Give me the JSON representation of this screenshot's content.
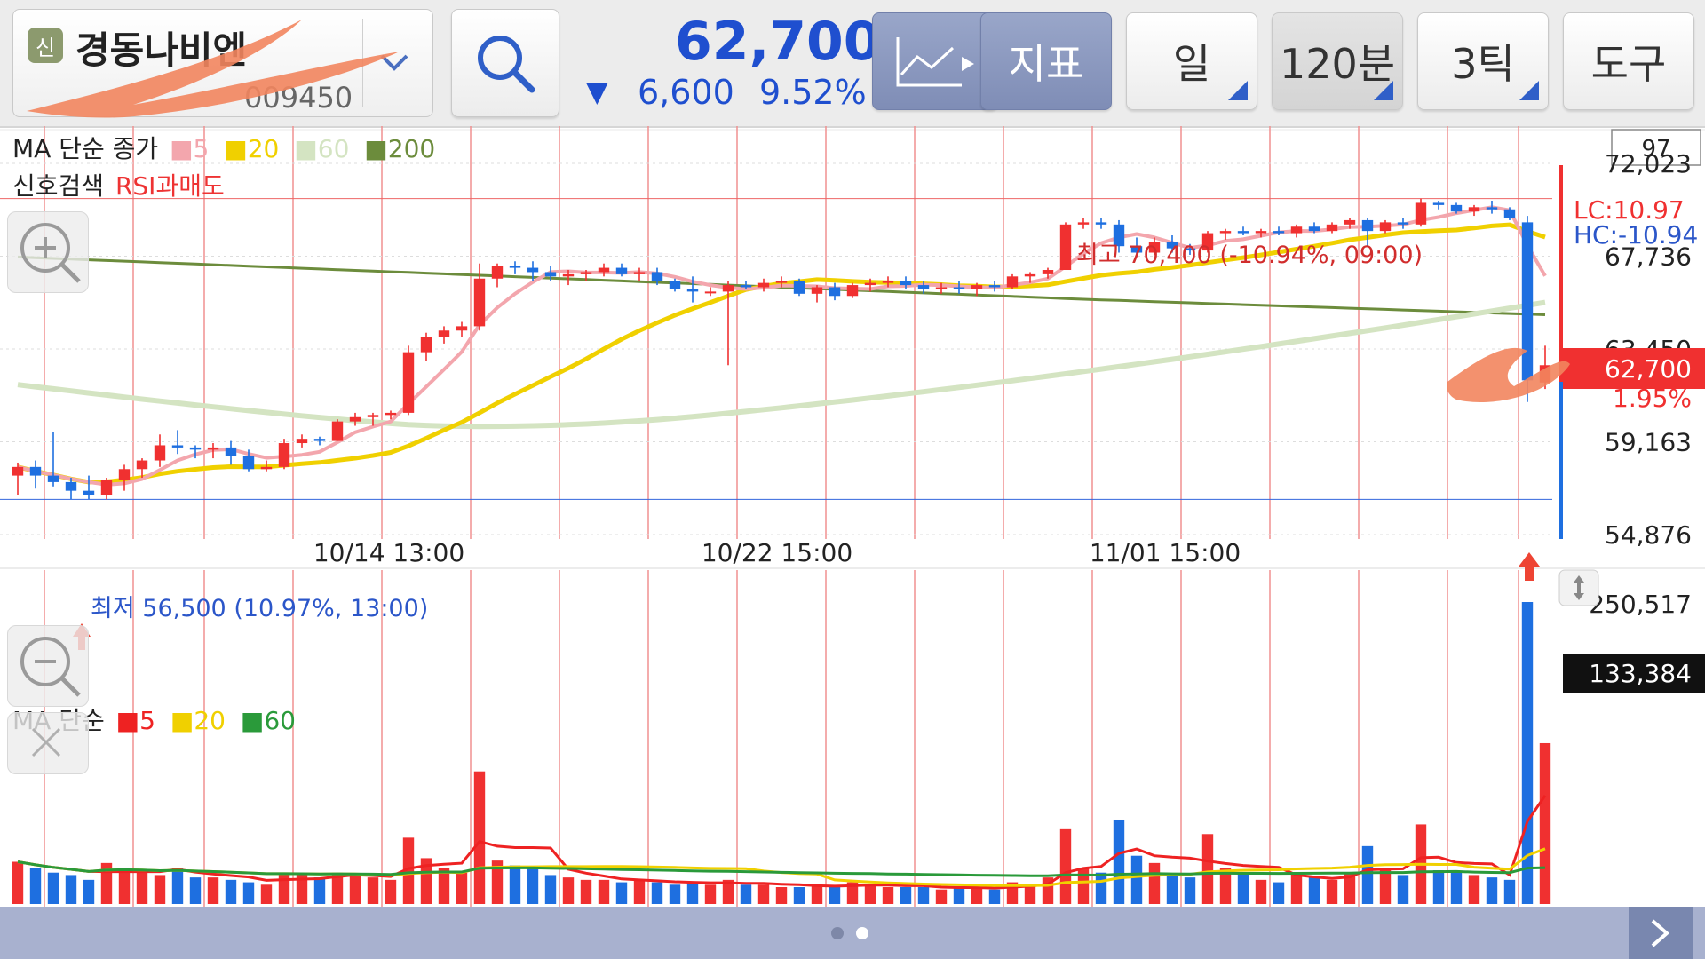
{
  "header": {
    "badge": "신",
    "stock_name": "경동나비엔",
    "stock_code": "009450",
    "price": "62,700",
    "change_arrow": "▼",
    "change_value": "6,600",
    "change_rate": "9.52%",
    "buttons": {
      "indicator": "지표",
      "period": "일",
      "interval": "120분",
      "tick": "3틱",
      "tools": "도구"
    },
    "icons": {
      "search": "search-icon",
      "chart_type": "line-chart-icon",
      "dropdown": "chevron-down-icon"
    }
  },
  "price_legend": {
    "title": "MA 단순 종가",
    "ma": [
      {
        "label": "5",
        "color": "#f3a6ad"
      },
      {
        "label": "20",
        "color": "#f0d000"
      },
      {
        "label": "60",
        "color": "#d4e4c2"
      },
      {
        "label": "200",
        "color": "#6c8c3c"
      }
    ],
    "signal_label": "신호검색",
    "signal_value": "RSI과매도"
  },
  "volume_legend": {
    "title": "MA 단순",
    "ma": [
      {
        "label": "5",
        "color": "#ee2222"
      },
      {
        "label": "20",
        "color": "#f0d000"
      },
      {
        "label": "60",
        "color": "#2a9a3a"
      }
    ]
  },
  "chart_data": {
    "type": "candlestick",
    "price_axis": {
      "ticks": [
        "72,023",
        "67,736",
        "63,450",
        "59,163",
        "54,876"
      ],
      "top_box": "97"
    },
    "current_price_tag": "62,700",
    "current_pct": "1.95%",
    "lc": "LC:10.97",
    "hc": "HC:-10.94",
    "high_annotation": "최고 70,400 (-10.94%, 09:00)",
    "low_annotation": "최저 56,500 (10.97%, 13:00)",
    "x_labels": [
      "10/14 13:00",
      "10/22 15:00",
      "11/01 15:00"
    ],
    "volume_axis": {
      "ticks": [
        "250,517"
      ],
      "current_tag": "133,384"
    },
    "candles": [
      [
        57600,
        58200,
        56700,
        58000
      ],
      [
        58000,
        58300,
        57000,
        57600
      ],
      [
        57600,
        59600,
        57100,
        57300
      ],
      [
        57300,
        57500,
        56500,
        56900
      ],
      [
        56900,
        57600,
        56500,
        56700
      ],
      [
        56700,
        57500,
        56500,
        57400
      ],
      [
        57400,
        58100,
        56900,
        57900
      ],
      [
        57900,
        58400,
        57500,
        58300
      ],
      [
        58300,
        59500,
        58000,
        59000
      ],
      [
        59000,
        59700,
        58600,
        58900
      ],
      [
        58900,
        59000,
        58400,
        58800
      ],
      [
        58800,
        59100,
        58400,
        58900
      ],
      [
        58900,
        59200,
        58100,
        58500
      ],
      [
        58500,
        58800,
        57800,
        57900
      ],
      [
        57900,
        58300,
        57800,
        58000
      ],
      [
        58000,
        59300,
        57900,
        59100
      ],
      [
        59100,
        59500,
        58900,
        59300
      ],
      [
        59300,
        59400,
        59000,
        59200
      ],
      [
        59200,
        60200,
        59200,
        60100
      ],
      [
        60100,
        60500,
        59900,
        60300
      ],
      [
        60300,
        60500,
        59900,
        60400
      ],
      [
        60400,
        60600,
        60200,
        60500
      ],
      [
        60500,
        63600,
        60400,
        63300
      ],
      [
        63300,
        64200,
        62900,
        64000
      ],
      [
        64000,
        64500,
        63700,
        64300
      ],
      [
        64300,
        64700,
        64000,
        64500
      ],
      [
        64500,
        67400,
        64300,
        66700
      ],
      [
        66700,
        67400,
        66300,
        67300
      ],
      [
        67300,
        67500,
        66900,
        67200
      ],
      [
        67200,
        67500,
        66600,
        67000
      ],
      [
        67000,
        67300,
        66600,
        66800
      ],
      [
        66800,
        67100,
        66400,
        66900
      ],
      [
        66900,
        67100,
        66600,
        67000
      ],
      [
        67000,
        67400,
        66800,
        67200
      ],
      [
        67200,
        67400,
        66800,
        66900
      ],
      [
        66900,
        67200,
        66600,
        67000
      ],
      [
        67000,
        67200,
        66400,
        66600
      ],
      [
        66600,
        66700,
        66100,
        66200
      ],
      [
        66200,
        66800,
        65600,
        66100
      ],
      [
        66100,
        66300,
        65900,
        66100
      ],
      [
        66100,
        66600,
        62700,
        66400
      ],
      [
        66400,
        66600,
        66200,
        66300
      ],
      [
        66300,
        66700,
        66100,
        66500
      ],
      [
        66500,
        66800,
        66300,
        66600
      ],
      [
        66600,
        66700,
        65900,
        66000
      ],
      [
        66000,
        66400,
        65600,
        66300
      ],
      [
        66300,
        66500,
        65700,
        65900
      ],
      [
        65900,
        66500,
        65800,
        66400
      ],
      [
        66400,
        66700,
        66100,
        66500
      ],
      [
        66500,
        66800,
        66300,
        66600
      ],
      [
        66600,
        66800,
        66200,
        66400
      ],
      [
        66400,
        66600,
        66000,
        66200
      ],
      [
        66200,
        66500,
        66000,
        66300
      ],
      [
        66300,
        66600,
        66000,
        66200
      ],
      [
        66200,
        66500,
        65900,
        66400
      ],
      [
        66400,
        66600,
        66100,
        66300
      ],
      [
        66300,
        66900,
        66200,
        66800
      ],
      [
        66800,
        67000,
        66500,
        66900
      ],
      [
        66900,
        67200,
        66700,
        67100
      ],
      [
        67100,
        69300,
        67100,
        69200
      ],
      [
        69200,
        69500,
        69000,
        69300
      ],
      [
        69300,
        69500,
        69000,
        69200
      ],
      [
        69200,
        69400,
        67900,
        68200
      ],
      [
        68200,
        68600,
        67700,
        67900
      ],
      [
        67900,
        68600,
        67800,
        68400
      ],
      [
        68400,
        68700,
        67900,
        68100
      ],
      [
        68100,
        68300,
        67800,
        68000
      ],
      [
        68000,
        68900,
        67900,
        68800
      ],
      [
        68800,
        69000,
        68500,
        68900
      ],
      [
        68900,
        69100,
        68700,
        68800
      ],
      [
        68800,
        69000,
        68600,
        68900
      ],
      [
        68900,
        69100,
        68700,
        68800
      ],
      [
        68800,
        69200,
        68600,
        69100
      ],
      [
        69100,
        69300,
        68800,
        68900
      ],
      [
        68900,
        69300,
        68800,
        69200
      ],
      [
        69200,
        69500,
        69000,
        69400
      ],
      [
        69400,
        69500,
        68200,
        68900
      ],
      [
        68900,
        69400,
        68800,
        69300
      ],
      [
        69300,
        69500,
        69000,
        69200
      ],
      [
        69200,
        70400,
        69100,
        70200
      ],
      [
        70200,
        70300,
        69900,
        70100
      ],
      [
        70100,
        70200,
        69700,
        69800
      ],
      [
        69800,
        70100,
        69600,
        70000
      ],
      [
        70000,
        70300,
        69700,
        69900
      ],
      [
        69900,
        70000,
        69400,
        69500
      ],
      [
        69300,
        69600,
        61000,
        62000
      ],
      [
        61900,
        63600,
        61600,
        62700
      ]
    ],
    "volume": [
      35000,
      30000,
      26000,
      24000,
      20000,
      34000,
      30000,
      26000,
      24000,
      30000,
      22000,
      22000,
      20000,
      18000,
      16000,
      25000,
      24000,
      22000,
      26000,
      24000,
      22000,
      20000,
      55000,
      38000,
      30000,
      26000,
      110000,
      36000,
      32000,
      30000,
      24000,
      22000,
      20000,
      20000,
      18000,
      20000,
      18000,
      16000,
      18000,
      16000,
      20000,
      16000,
      16000,
      14000,
      14000,
      16000,
      14000,
      18000,
      16000,
      14000,
      14000,
      14000,
      12000,
      14000,
      14000,
      12000,
      18000,
      16000,
      22000,
      62000,
      30000,
      26000,
      70000,
      40000,
      34000,
      24000,
      22000,
      58000,
      30000,
      26000,
      20000,
      18000,
      26000,
      22000,
      20000,
      26000,
      48000,
      28000,
      24000,
      66000,
      28000,
      26000,
      24000,
      22000,
      20000,
      250517,
      133384
    ]
  }
}
